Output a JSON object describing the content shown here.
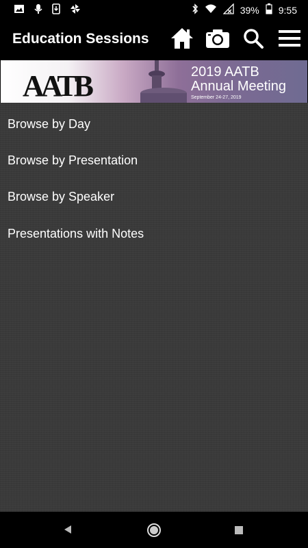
{
  "status_bar": {
    "battery": "39%",
    "time": "9:55",
    "left_icons": [
      "image-icon",
      "mic-icon",
      "download-icon",
      "pinwheel-icon"
    ],
    "right_icons": [
      "bluetooth-icon",
      "wifi-icon",
      "no-signal-icon",
      "battery-icon"
    ]
  },
  "app_bar": {
    "title": "Education Sessions",
    "actions": [
      "home-icon",
      "camera-icon",
      "search-icon",
      "menu-icon"
    ]
  },
  "banner": {
    "logo": "AATB",
    "title_line1": "2019 AATB",
    "title_line2": "Annual Meeting",
    "dates": "September 24-27, 2019"
  },
  "menu": {
    "items": [
      {
        "label": "Browse by Day"
      },
      {
        "label": "Browse by Presentation"
      },
      {
        "label": "Browse by Speaker"
      },
      {
        "label": "Presentations with Notes"
      }
    ]
  },
  "nav_bar": {
    "buttons": [
      "back-icon",
      "home-circle-icon",
      "recents-icon"
    ]
  }
}
